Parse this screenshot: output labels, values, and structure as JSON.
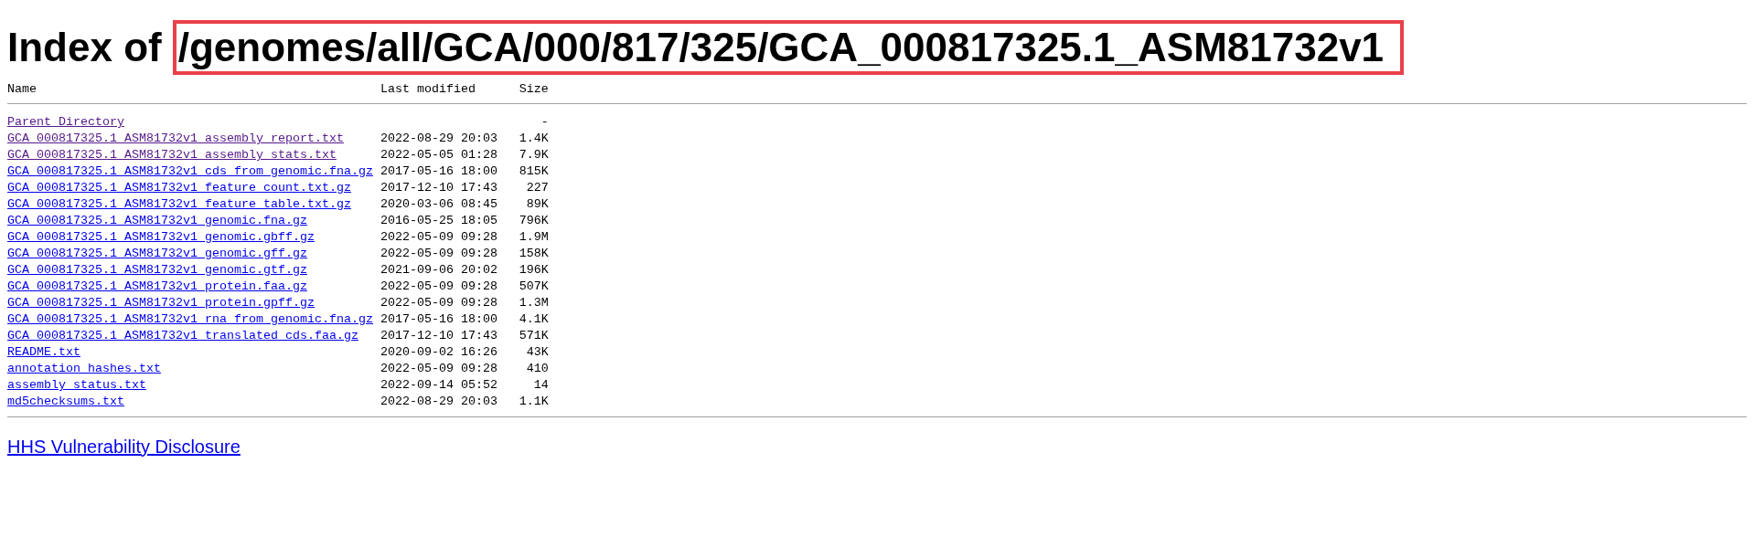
{
  "title": {
    "prefix": "Index of",
    "path": "/genomes/all/GCA/000/817/325/GCA_000817325.1_ASM81732v1",
    "highlighted": true
  },
  "table": {
    "columns": [
      "Name",
      "Last modified",
      "Size"
    ],
    "rows": [
      {
        "name": "Parent Directory",
        "size": "-",
        "visited": true
      },
      {
        "name": "GCA_000817325.1_ASM81732v1_assembly_report.txt",
        "last_modified": "2022-08-29 20:03",
        "size": "1.4K",
        "visited": true
      },
      {
        "name": "GCA_000817325.1_ASM81732v1_assembly_stats.txt",
        "last_modified": "2022-05-05 01:28",
        "size": "7.9K",
        "visited": true
      },
      {
        "name": "GCA_000817325.1_ASM81732v1_cds_from_genomic.fna.gz",
        "last_modified": "2017-05-16 18:00",
        "size": "815K",
        "visited": false
      },
      {
        "name": "GCA_000817325.1_ASM81732v1_feature_count.txt.gz",
        "last_modified": "2017-12-10 17:43",
        "size": "227",
        "visited": false
      },
      {
        "name": "GCA_000817325.1_ASM81732v1_feature_table.txt.gz",
        "last_modified": "2020-03-06 08:45",
        "size": "89K",
        "visited": false
      },
      {
        "name": "GCA_000817325.1_ASM81732v1_genomic.fna.gz",
        "last_modified": "2016-05-25 18:05",
        "size": "796K",
        "visited": false
      },
      {
        "name": "GCA_000817325.1_ASM81732v1_genomic.gbff.gz",
        "last_modified": "2022-05-09 09:28",
        "size": "1.9M",
        "visited": false
      },
      {
        "name": "GCA_000817325.1_ASM81732v1_genomic.gff.gz",
        "last_modified": "2022-05-09 09:28",
        "size": "158K",
        "visited": false
      },
      {
        "name": "GCA_000817325.1_ASM81732v1_genomic.gtf.gz",
        "last_modified": "2021-09-06 20:02",
        "size": "196K",
        "visited": false
      },
      {
        "name": "GCA_000817325.1_ASM81732v1_protein.faa.gz",
        "last_modified": "2022-05-09 09:28",
        "size": "507K",
        "visited": false
      },
      {
        "name": "GCA_000817325.1_ASM81732v1_protein.gpff.gz",
        "last_modified": "2022-05-09 09:28",
        "size": "1.3M",
        "visited": false
      },
      {
        "name": "GCA_000817325.1_ASM81732v1_rna_from_genomic.fna.gz",
        "last_modified": "2017-05-16 18:00",
        "size": "4.1K",
        "visited": false
      },
      {
        "name": "GCA_000817325.1_ASM81732v1_translated_cds.faa.gz",
        "last_modified": "2017-12-10 17:43",
        "size": "571K",
        "visited": false
      },
      {
        "name": "README.txt",
        "last_modified": "2020-09-02 16:26",
        "size": "43K",
        "visited": false
      },
      {
        "name": "annotation_hashes.txt",
        "last_modified": "2022-05-09 09:28",
        "size": "410",
        "visited": false
      },
      {
        "name": "assembly_status.txt",
        "last_modified": "2022-09-14 05:52",
        "size": "14",
        "visited": false
      },
      {
        "name": "md5checksums.txt",
        "last_modified": "2022-08-29 20:03",
        "size": "1.1K",
        "visited": false
      }
    ]
  },
  "footer_link": "HHS Vulnerability Disclosure"
}
